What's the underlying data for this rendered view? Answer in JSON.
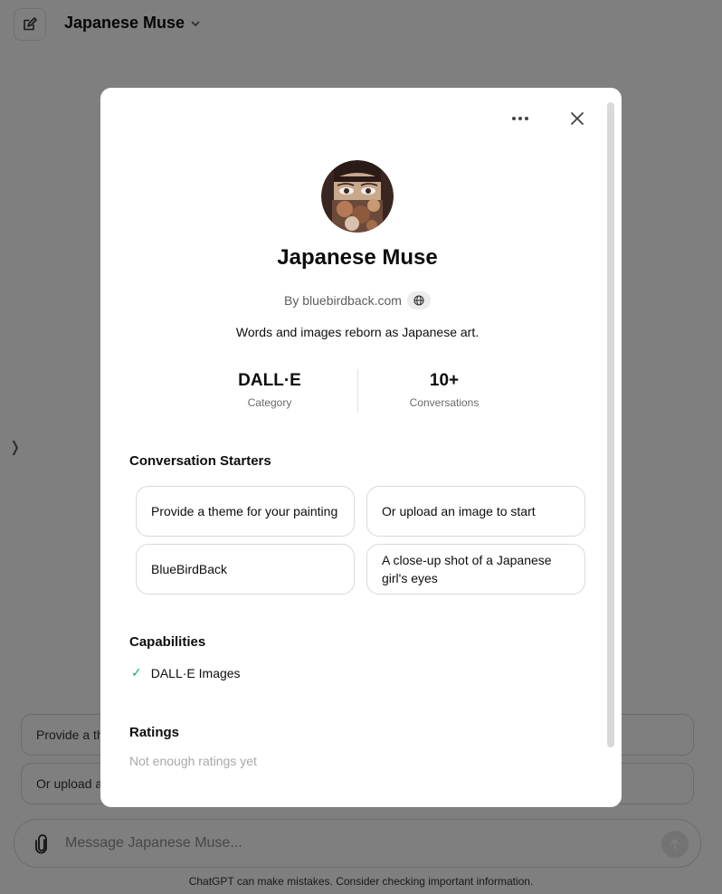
{
  "header": {
    "title": "Japanese Muse"
  },
  "background_suggestions": [
    "Provide a th",
    "Or upload a"
  ],
  "composer": {
    "placeholder": "Message Japanese Muse..."
  },
  "disclaimer": "ChatGPT can make mistakes. Consider checking important information.",
  "modal": {
    "name": "Japanese Muse",
    "author": "By bluebirdback.com",
    "description": "Words and images reborn as Japanese art.",
    "stats": [
      {
        "value": "DALL·E",
        "label": "Category"
      },
      {
        "value": "10+",
        "label": "Conversations"
      }
    ],
    "starters_heading": "Conversation Starters",
    "starters": [
      "Provide a theme for your painting",
      "Or upload an image to start",
      "BlueBirdBack",
      "A close-up shot of a Japanese girl's eyes"
    ],
    "capabilities_heading": "Capabilities",
    "capabilities": [
      "DALL·E Images"
    ],
    "ratings_heading": "Ratings",
    "ratings_note": "Not enough ratings yet"
  },
  "colors": {
    "accent_check": "#19a37f",
    "overlay": "rgba(0,0,0,0.5)"
  },
  "icons": [
    "edit-icon",
    "chevron-down-icon",
    "paperclip-icon",
    "arrow-up-icon",
    "more-icon",
    "close-icon",
    "globe-icon",
    "check-icon"
  ]
}
